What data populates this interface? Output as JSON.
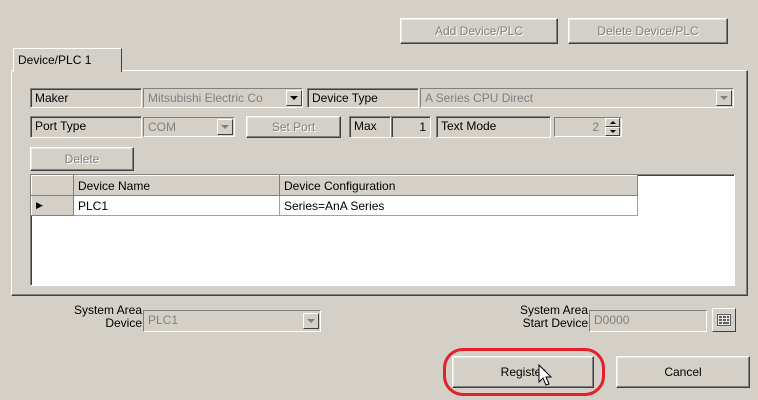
{
  "toolbar": {
    "add_device": "Add Device/PLC",
    "delete_device": "Delete Device/PLC"
  },
  "tab": {
    "label": "Device/PLC 1"
  },
  "row1": {
    "maker_label": "Maker",
    "maker_value": "Mitsubishi Electric Co",
    "device_type_label": "Device Type",
    "device_type_value": "A Series CPU Direct"
  },
  "row2": {
    "port_type_label": "Port Type",
    "port_type_value": "COM",
    "set_port_button": "Set Port",
    "max_label": "Max",
    "max_value": "1",
    "text_mode_label": "Text Mode",
    "text_mode_value": "2"
  },
  "delete_button": "Delete",
  "table": {
    "columns": [
      "Device Name",
      "Device Configuration"
    ],
    "rows": [
      {
        "indicator": "▶",
        "name": "PLC1",
        "config": "Series=AnA Series"
      }
    ]
  },
  "system_area_device": {
    "label_line1": "System Area",
    "label_line2": "Device",
    "value": "PLC1"
  },
  "system_area_start": {
    "label_line1": "System Area",
    "label_line2": "Start Device",
    "value": "D0000"
  },
  "footer": {
    "register": "Register",
    "cancel": "Cancel"
  },
  "colors": {
    "face": "#d4d0c8",
    "highlight_ring": "#e3202a"
  }
}
